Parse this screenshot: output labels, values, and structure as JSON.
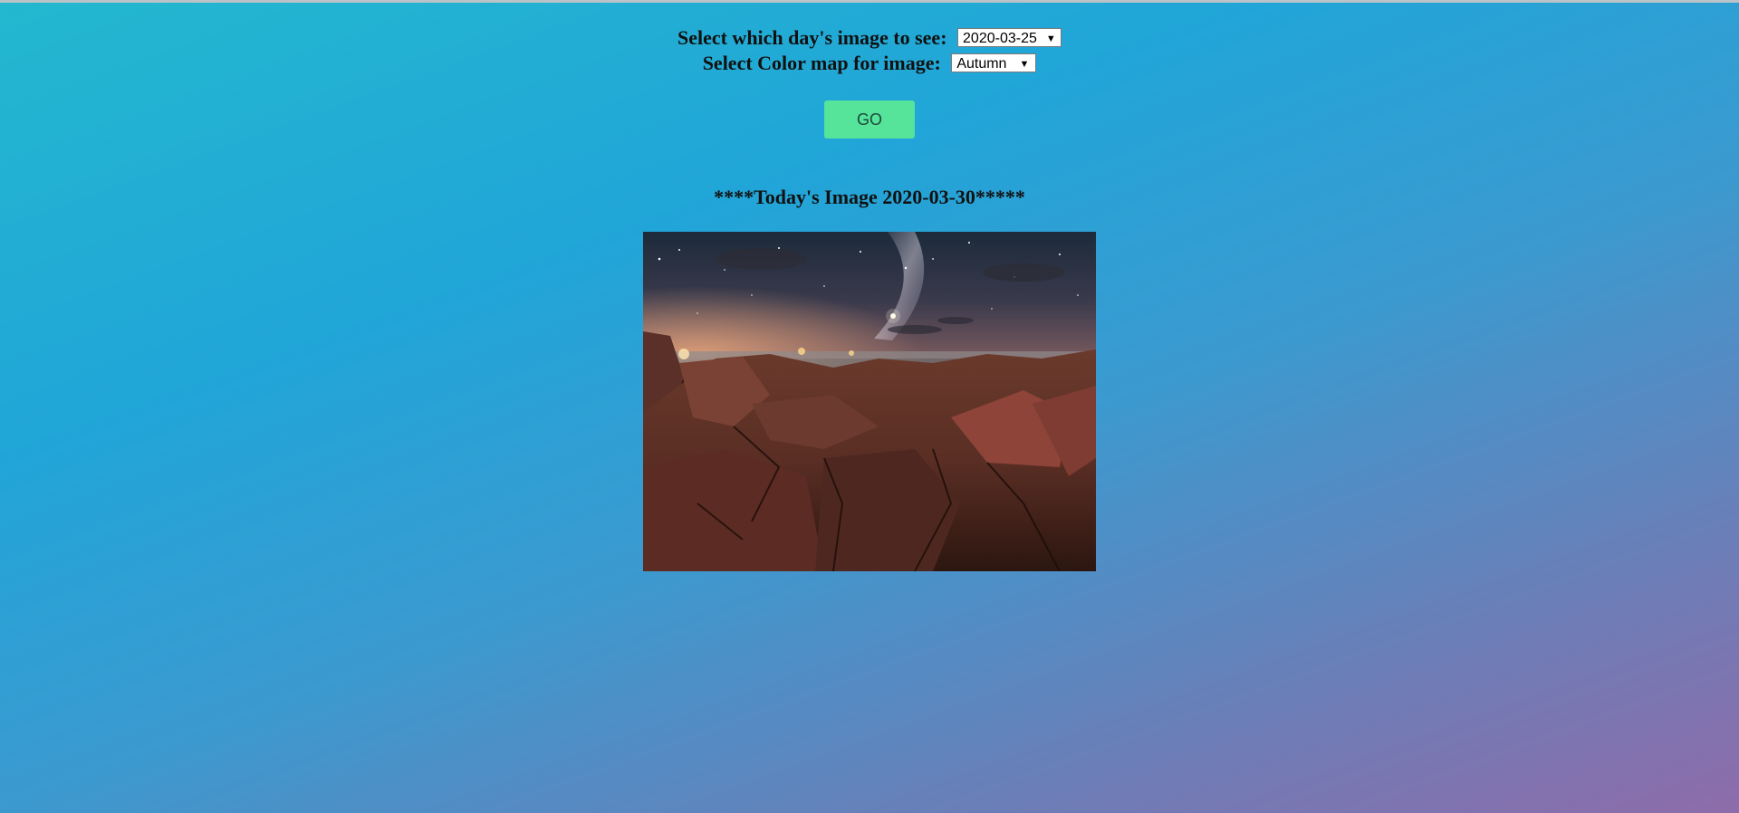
{
  "form": {
    "day_label": "Select which day's image to see:",
    "day_select": {
      "value": "2020-03-25"
    },
    "colormap_label": "Select Color map for image:",
    "colormap_select": {
      "value": "Autumn"
    },
    "go_button": "GO"
  },
  "heading": "****Today's Image 2020-03-30*****",
  "image": {
    "subject": "night sky with milky way over rocky coastline"
  },
  "icons": {
    "dropdown": "triangle-down-icon"
  }
}
